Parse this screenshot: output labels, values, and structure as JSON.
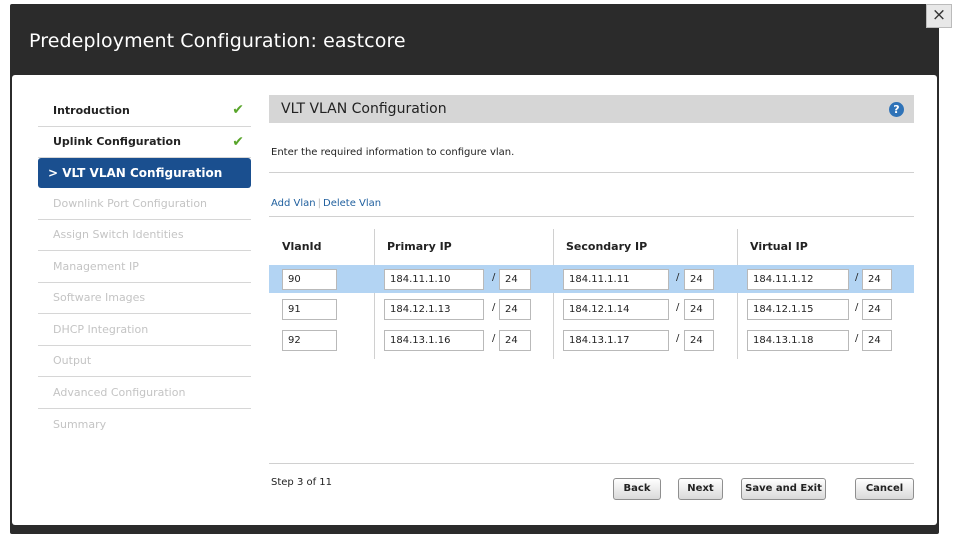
{
  "dialog": {
    "title": "Predeployment Configuration: eastcore",
    "close_label": "×"
  },
  "sidebar": {
    "items": [
      {
        "label": "Introduction",
        "state": "done"
      },
      {
        "label": "Uplink Configuration",
        "state": "done"
      },
      {
        "label": "> VLT VLAN Configuration",
        "state": "active"
      },
      {
        "label": "Downlink Port Configuration",
        "state": "disabled"
      },
      {
        "label": "Assign Switch Identities",
        "state": "disabled"
      },
      {
        "label": "Management IP",
        "state": "disabled"
      },
      {
        "label": "Software Images",
        "state": "disabled"
      },
      {
        "label": "DHCP Integration",
        "state": "disabled"
      },
      {
        "label": "Output",
        "state": "disabled"
      },
      {
        "label": "Advanced Configuration",
        "state": "disabled"
      },
      {
        "label": "Summary",
        "state": "disabled"
      }
    ],
    "check_glyph": "✔"
  },
  "main": {
    "header": "VLT VLAN Configuration",
    "help_glyph": "?",
    "instructions": "Enter the required information to configure vlan.",
    "add_vlan": "Add Vlan",
    "delete_vlan": "Delete Vlan",
    "columns": [
      "VlanId",
      "Primary IP",
      "Secondary IP",
      "Virtual IP"
    ],
    "rows": [
      {
        "vlan": "90",
        "primary": "184.11.1.10",
        "primary_mask": "24",
        "secondary": "184.11.1.11",
        "secondary_mask": "24",
        "virtual": "184.11.1.12",
        "virtual_mask": "24"
      },
      {
        "vlan": "91",
        "primary": "184.12.1.13",
        "primary_mask": "24",
        "secondary": "184.12.1.14",
        "secondary_mask": "24",
        "virtual": "184.12.1.15",
        "virtual_mask": "24"
      },
      {
        "vlan": "92",
        "primary": "184.13.1.16",
        "primary_mask": "24",
        "secondary": "184.13.1.17",
        "secondary_mask": "24",
        "virtual": "184.13.1.18",
        "virtual_mask": "24"
      }
    ],
    "slash": "/"
  },
  "footer": {
    "step": "Step 3 of 11",
    "back": "Back",
    "next": "Next",
    "save_exit": "Save and Exit",
    "cancel": "Cancel"
  },
  "colors": {
    "active_nav": "#1a4f8f",
    "selected_row": "#b3d4f3",
    "check": "#58a52a",
    "link": "#1f5f9e"
  }
}
